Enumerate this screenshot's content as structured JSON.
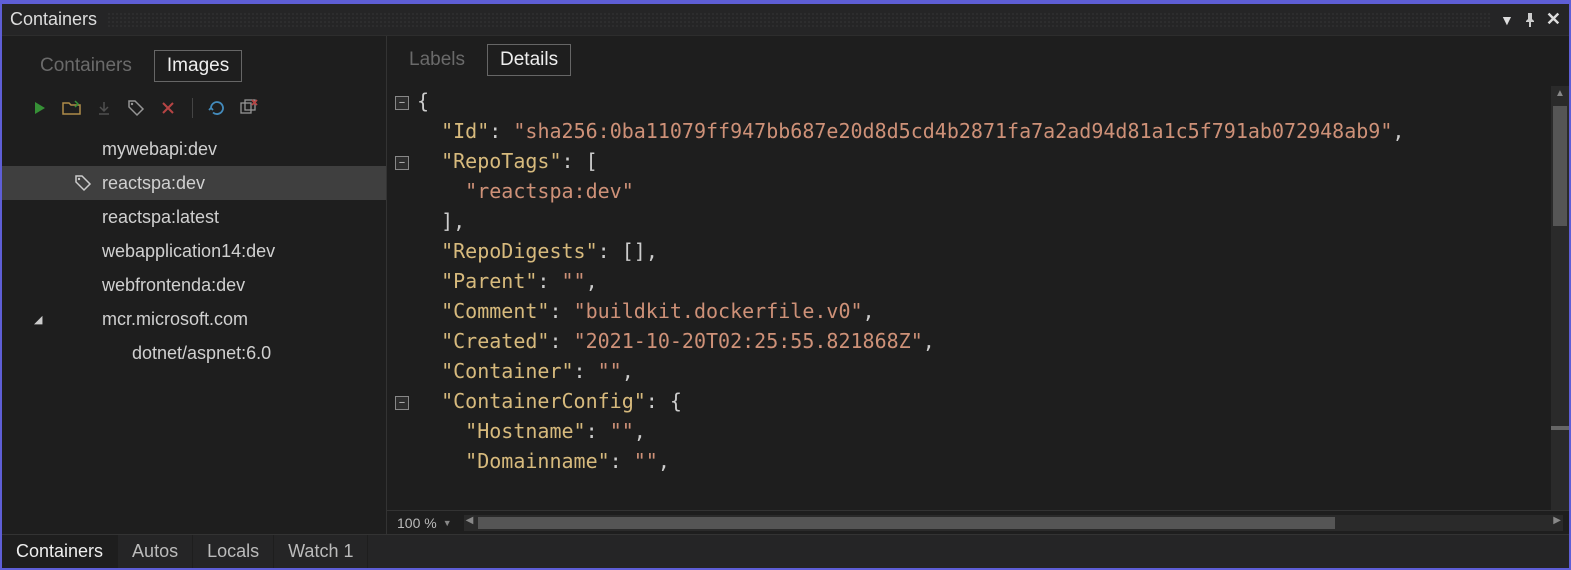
{
  "window": {
    "title": "Containers"
  },
  "leftTabs": {
    "inactive": "Containers",
    "active": "Images"
  },
  "toolbar": {
    "run": "run-icon",
    "open": "open-icon",
    "pull": "pull-icon",
    "tag": "tag-icon",
    "delete": "delete-icon",
    "refresh": "refresh-icon",
    "prune": "prune-icon"
  },
  "images": [
    {
      "label": "mywebapi:dev",
      "level": "child",
      "selected": false
    },
    {
      "label": "reactspa:dev",
      "level": "child",
      "selected": true,
      "hasTag": true
    },
    {
      "label": "reactspa:latest",
      "level": "child",
      "selected": false
    },
    {
      "label": "webapplication14:dev",
      "level": "child",
      "selected": false
    },
    {
      "label": "webfrontenda:dev",
      "level": "child",
      "selected": false
    },
    {
      "label": "mcr.microsoft.com",
      "level": "root",
      "selected": false,
      "expandable": true
    },
    {
      "label": "dotnet/aspnet:6.0",
      "level": "grandchild",
      "selected": false
    }
  ],
  "rightTabs": {
    "inactive": "Labels",
    "active": "Details"
  },
  "json": {
    "open": "{",
    "id_key": "\"Id\"",
    "id_val": "\"sha256:0ba11079ff947bb687e20d8d5cd4b2871fa7a2ad94d81a1c5f791ab072948ab9\"",
    "repotags_key": "\"RepoTags\"",
    "repotags_open": "[",
    "repotags_item": "\"reactspa:dev\"",
    "repotags_close": "],",
    "repodigests_key": "\"RepoDigests\"",
    "repodigests_val": "[],",
    "parent_key": "\"Parent\"",
    "parent_val": "\"\"",
    "comment_key": "\"Comment\"",
    "comment_val": "\"buildkit.dockerfile.v0\"",
    "created_key": "\"Created\"",
    "created_val": "\"2021-10-20T02:25:55.821868Z\"",
    "container_key": "\"Container\"",
    "container_val": "\"\"",
    "containerconfig_key": "\"ContainerConfig\"",
    "containerconfig_open": "{",
    "hostname_key": "\"Hostname\"",
    "hostname_val": "\"\"",
    "domainname_key": "\"Domainname\"",
    "domainname_val": "\"\""
  },
  "status": {
    "zoom": "100 %"
  },
  "bottomTabs": [
    "Containers",
    "Autos",
    "Locals",
    "Watch 1"
  ]
}
